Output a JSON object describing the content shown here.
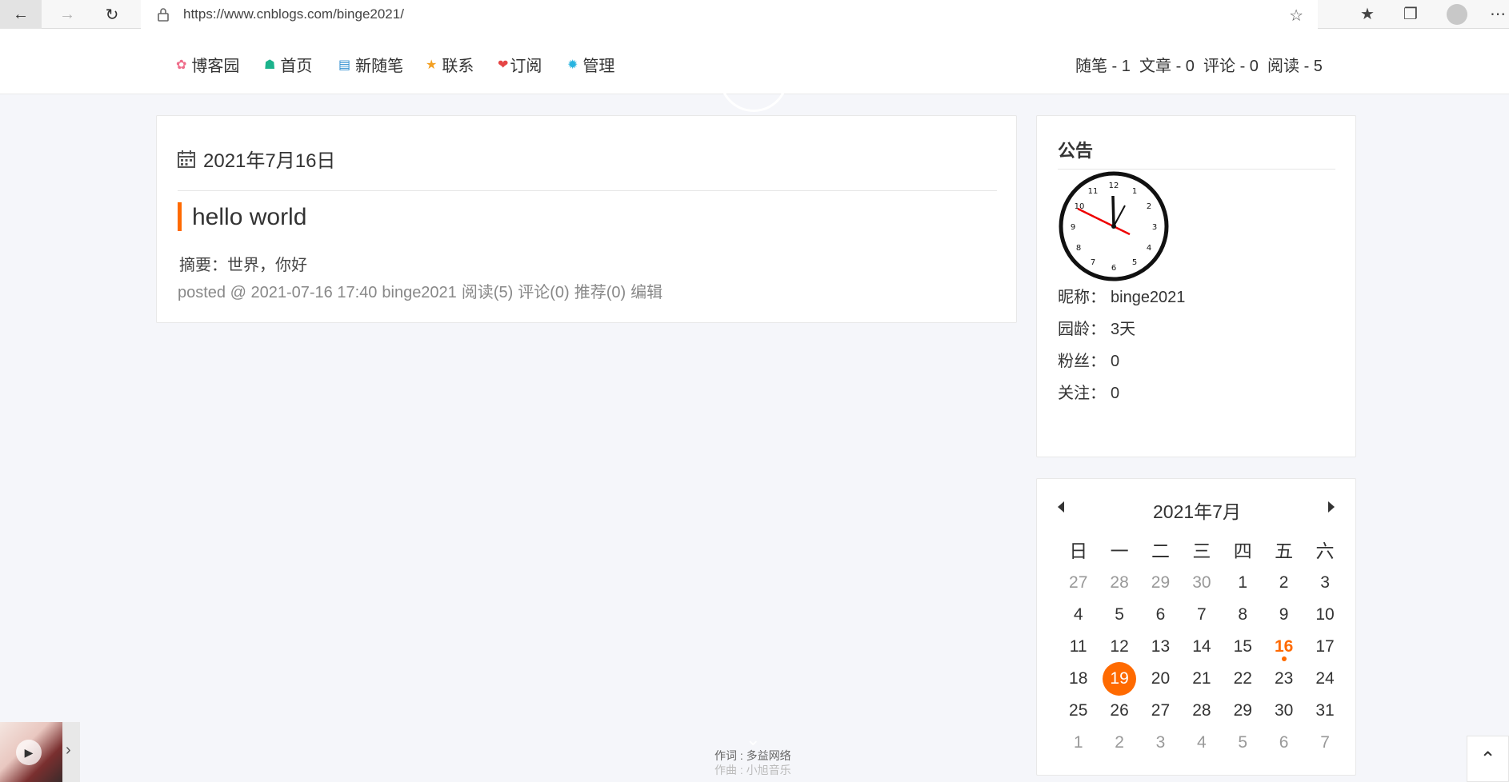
{
  "browser": {
    "url": "https://www.cnblogs.com/binge2021/"
  },
  "header": {
    "nav": [
      {
        "label": "博客园",
        "icon": "flower-icon",
        "color": "#ef6c8a"
      },
      {
        "label": "首页",
        "icon": "home-icon",
        "color": "#1bb38c"
      },
      {
        "label": "新随笔",
        "icon": "edit-icon",
        "color": "#2b8ccf"
      },
      {
        "label": "联系",
        "icon": "star-icon",
        "color": "#f3a023"
      },
      {
        "label": "订阅",
        "icon": "heart-icon",
        "color": "#e54545"
      },
      {
        "label": "管理",
        "icon": "gear-icon",
        "color": "#28b4e0"
      }
    ],
    "stats": "随笔 - 1  文章 - 0  评论 - 0  阅读 - 5"
  },
  "post": {
    "date": "2021年7月16日",
    "title": "hello world",
    "summary": "摘要：世界，你好",
    "meta": {
      "posted": "posted @ 2021-07-16 17:40",
      "author": "binge2021",
      "read": "阅读(5)",
      "comment": "评论(0)",
      "recommend": "推荐(0)",
      "edit": "编辑"
    }
  },
  "sidebar": {
    "notice_title": "公告",
    "profile": [
      {
        "label": "昵称：",
        "value": "binge2021"
      },
      {
        "label": "园龄：",
        "value": "3天"
      },
      {
        "label": "粉丝：",
        "value": "0"
      },
      {
        "label": "关注：",
        "value": "0"
      }
    ]
  },
  "calendar": {
    "title": "2021年7月",
    "weekdays": [
      "日",
      "一",
      "二",
      "三",
      "四",
      "五",
      "六"
    ],
    "weeks": [
      [
        "27",
        "28",
        "29",
        "30",
        "1",
        "2",
        "3"
      ],
      [
        "4",
        "5",
        "6",
        "7",
        "8",
        "9",
        "10"
      ],
      [
        "11",
        "12",
        "13",
        "14",
        "15",
        "16",
        "17"
      ],
      [
        "18",
        "19",
        "20",
        "21",
        "22",
        "23",
        "24"
      ],
      [
        "25",
        "26",
        "27",
        "28",
        "29",
        "30",
        "31"
      ],
      [
        "1",
        "2",
        "3",
        "4",
        "5",
        "6",
        "7"
      ]
    ],
    "post_day": "16",
    "today": "19",
    "accent": "#ff6a00"
  },
  "music": {
    "lyric_line1": "作词 : 多益网络",
    "lyric_line2": "作曲 : 小旭音乐"
  }
}
